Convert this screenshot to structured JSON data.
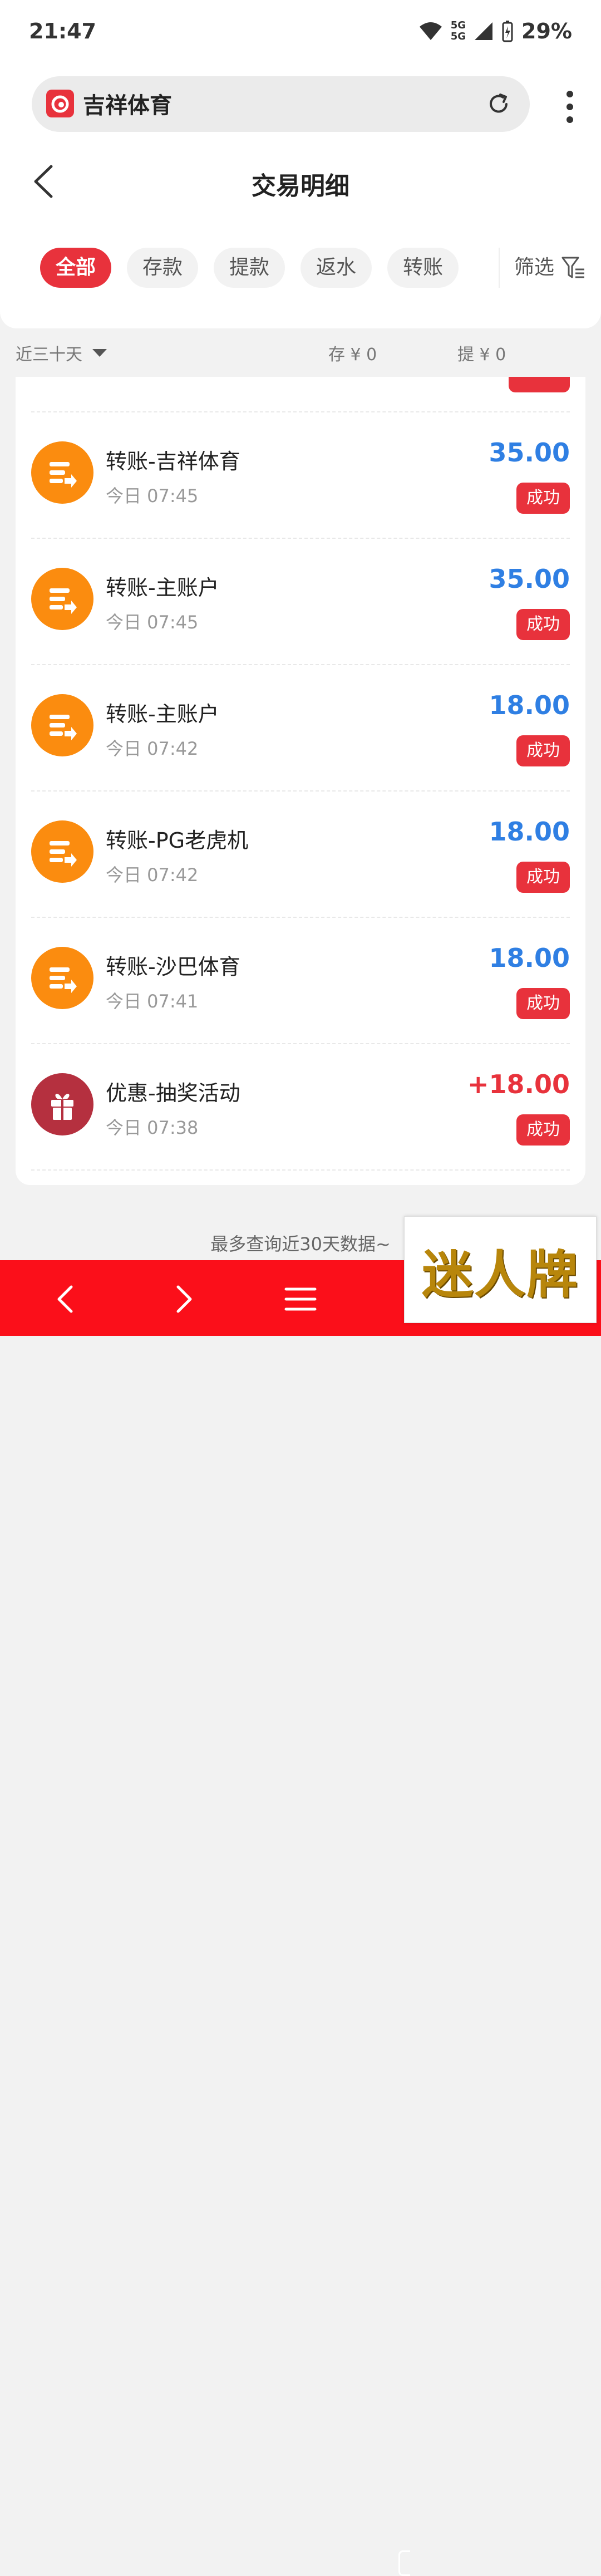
{
  "status_bar": {
    "time": "21:47",
    "network": "5G",
    "battery": "29%"
  },
  "browser": {
    "site_title": "吉祥体育"
  },
  "header": {
    "title": "交易明细"
  },
  "tabs": [
    {
      "label": "全部",
      "active": true
    },
    {
      "label": "存款"
    },
    {
      "label": "提款"
    },
    {
      "label": "返水"
    },
    {
      "label": "转账"
    }
  ],
  "filter_label": "筛选",
  "summary": {
    "range": "近三十天",
    "deposit": "存 ¥ 0",
    "withdraw": "提 ¥ 0"
  },
  "transactions": [
    {
      "name": "转账-吉祥体育",
      "time": "今日 07:45",
      "amount": "35.00",
      "status": "成功",
      "icon": "transfer-icon"
    },
    {
      "name": "转账-主账户",
      "time": "今日 07:45",
      "amount": "35.00",
      "status": "成功",
      "icon": "transfer-icon"
    },
    {
      "name": "转账-主账户",
      "time": "今日 07:42",
      "amount": "18.00",
      "status": "成功",
      "icon": "transfer-icon"
    },
    {
      "name": "转账-PG老虎机",
      "time": "今日 07:42",
      "amount": "18.00",
      "status": "成功",
      "icon": "transfer-icon"
    },
    {
      "name": "转账-沙巴体育",
      "time": "今日 07:41",
      "amount": "18.00",
      "status": "成功",
      "icon": "transfer-icon"
    },
    {
      "name": "优惠-抽奖活动",
      "time": "今日 07:38",
      "amount": "+18.00",
      "status": "成功",
      "icon": "gift-icon"
    }
  ],
  "footer_note": "最多查询近30天数据~",
  "ad_text": "迷人牌",
  "colors": {
    "accent": "#e8323c",
    "amount_blue": "#2f7fe3",
    "transfer_orange": "#fb8c0f",
    "gift_red": "#b5303f",
    "nav_red": "#fb0f1a"
  }
}
